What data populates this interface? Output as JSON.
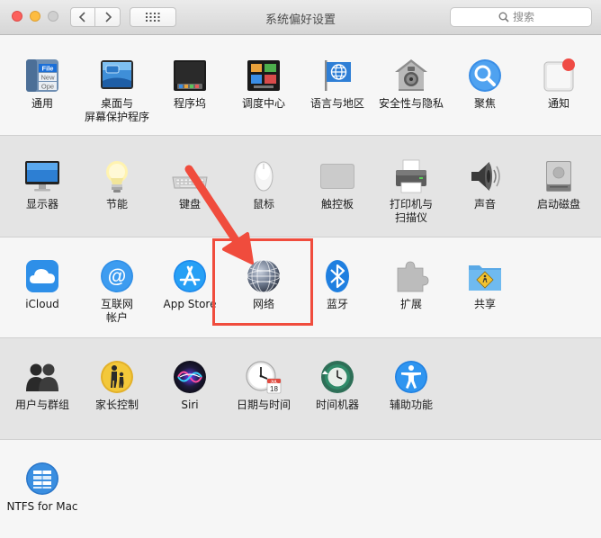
{
  "window": {
    "title": "系统偏好设置"
  },
  "search": {
    "placeholder": "搜索"
  },
  "rows": [
    {
      "items": [
        {
          "label": "通用",
          "icon": "general-icon",
          "icon_text": [
            "File",
            "New",
            "Ope"
          ]
        },
        {
          "label": "桌面与\n屏幕保护程序",
          "icon": "desktop-screensaver-icon"
        },
        {
          "label": "程序坞",
          "icon": "dock-icon"
        },
        {
          "label": "调度中心",
          "icon": "mission-control-icon"
        },
        {
          "label": "语言与地区",
          "icon": "language-region-icon"
        },
        {
          "label": "安全性与隐私",
          "icon": "security-privacy-icon"
        },
        {
          "label": "聚焦",
          "icon": "spotlight-icon"
        },
        {
          "label": "通知",
          "icon": "notifications-icon"
        }
      ]
    },
    {
      "items": [
        {
          "label": "显示器",
          "icon": "displays-icon"
        },
        {
          "label": "节能",
          "icon": "energy-saver-icon"
        },
        {
          "label": "键盘",
          "icon": "keyboard-icon"
        },
        {
          "label": "鼠标",
          "icon": "mouse-icon"
        },
        {
          "label": "触控板",
          "icon": "trackpad-icon"
        },
        {
          "label": "打印机与\n扫描仪",
          "icon": "printers-scanners-icon"
        },
        {
          "label": "声音",
          "icon": "sound-icon"
        },
        {
          "label": "启动磁盘",
          "icon": "startup-disk-icon"
        }
      ]
    },
    {
      "items": [
        {
          "label": "iCloud",
          "icon": "icloud-icon"
        },
        {
          "label": "互联网\n帐户",
          "icon": "internet-accounts-icon"
        },
        {
          "label": "App Store",
          "icon": "app-store-icon"
        },
        {
          "label": "网络",
          "icon": "network-icon"
        },
        {
          "label": "蓝牙",
          "icon": "bluetooth-icon"
        },
        {
          "label": "扩展",
          "icon": "extensions-icon"
        },
        {
          "label": "共享",
          "icon": "sharing-icon"
        }
      ]
    },
    {
      "items": [
        {
          "label": "用户与群组",
          "icon": "users-groups-icon"
        },
        {
          "label": "家长控制",
          "icon": "parental-controls-icon"
        },
        {
          "label": "Siri",
          "icon": "siri-icon"
        },
        {
          "label": "日期与时间",
          "icon": "date-time-icon",
          "icon_text": [
            "JUL",
            "18"
          ]
        },
        {
          "label": "时间机器",
          "icon": "time-machine-icon"
        },
        {
          "label": "辅助功能",
          "icon": "accessibility-icon"
        }
      ]
    },
    {
      "items": [
        {
          "label": "NTFS for Mac",
          "icon": "ntfs-for-mac-icon"
        }
      ]
    }
  ],
  "annotation": {
    "color": "#f04c3d",
    "target_icon": "network-icon"
  }
}
